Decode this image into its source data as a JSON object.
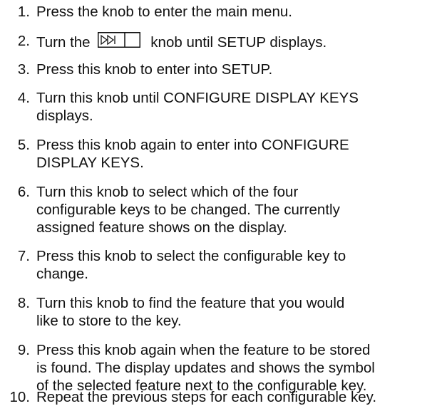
{
  "steps": [
    {
      "number": "1.",
      "lines": [
        "Press the knob to enter the main menu."
      ]
    },
    {
      "number": "2.",
      "prefix": "Turn the",
      "icon": "step-knob-icon",
      "suffix": "knob until SETUP displays."
    },
    {
      "number": "3.",
      "lines": [
        "Press this knob to enter into SETUP."
      ]
    },
    {
      "number": "4.",
      "lines": [
        "Turn this knob until CONFIGURE DISPLAY KEYS",
        "displays."
      ]
    },
    {
      "number": "5.",
      "lines": [
        "Press this knob again to enter into CONFIGURE",
        "DISPLAY KEYS."
      ]
    },
    {
      "number": "6.",
      "lines": [
        "Turn this knob to select which of the four",
        "configurable keys to be changed. The currently",
        "assigned feature shows on the display."
      ]
    },
    {
      "number": "7.",
      "lines": [
        "Press this knob to select the configurable key to",
        "change."
      ]
    },
    {
      "number": "8.",
      "lines": [
        "Turn this knob to find the feature that you would",
        "like to store to the key."
      ]
    },
    {
      "number": "9.",
      "lines": [
        "Press this knob again when the feature to be stored",
        "is found. The display updates and shows the symbol",
        "of the selected feature next to the configurable key."
      ]
    },
    {
      "number": "10.",
      "lines": [
        "Repeat the previous steps for each configurable key."
      ]
    }
  ]
}
